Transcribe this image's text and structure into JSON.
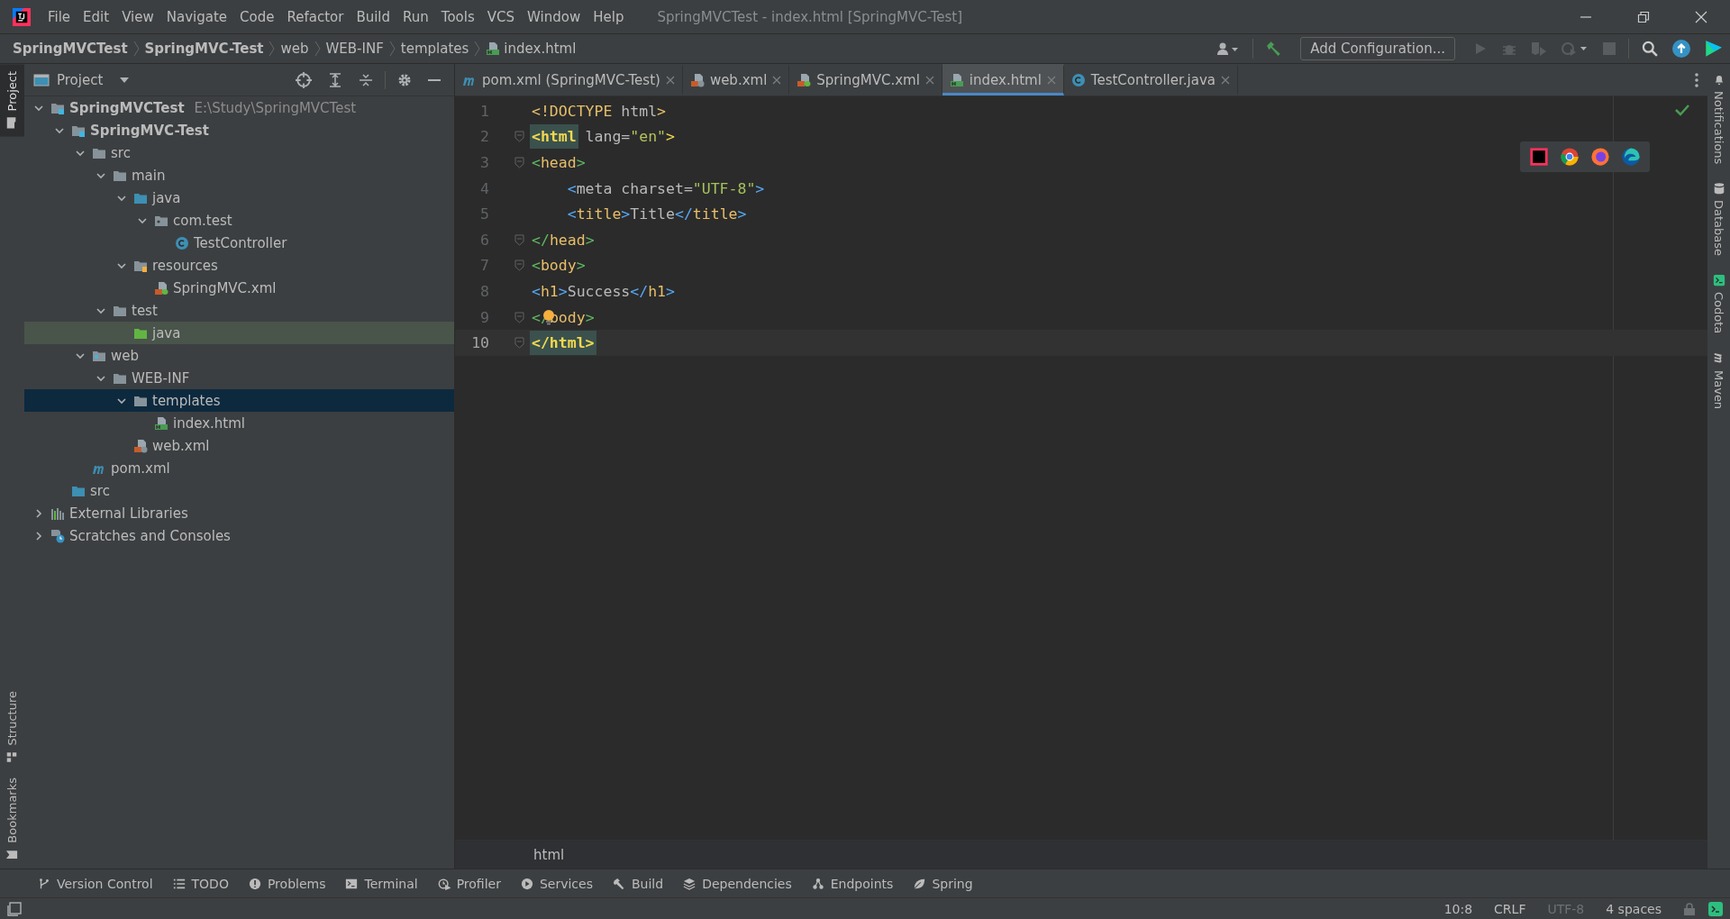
{
  "window": {
    "title": "SpringMVCTest - index.html [SpringMVC-Test]"
  },
  "menu": [
    "File",
    "Edit",
    "View",
    "Navigate",
    "Code",
    "Refactor",
    "Build",
    "Run",
    "Tools",
    "VCS",
    "Window",
    "Help"
  ],
  "breadcrumb": [
    {
      "label": "SpringMVCTest",
      "kind": "module"
    },
    {
      "label": "SpringMVC-Test",
      "kind": "module"
    },
    {
      "label": "web",
      "kind": "folder"
    },
    {
      "label": "WEB-INF",
      "kind": "folder"
    },
    {
      "label": "templates",
      "kind": "folder"
    },
    {
      "label": "index.html",
      "kind": "html"
    }
  ],
  "toolbar": {
    "config_button": "Add Configuration..."
  },
  "left_stripe": [
    {
      "label": "Project",
      "kind": "project",
      "selected": true
    },
    {
      "label": "Structure",
      "kind": "structure",
      "selected": false
    },
    {
      "label": "Bookmarks",
      "kind": "bookmarks",
      "selected": false
    }
  ],
  "project_panel": {
    "title": "Project",
    "tree": [
      {
        "label": "SpringMVCTest",
        "path": "E:\\Study\\SpringMVCTest",
        "kind": "module",
        "expanded": true,
        "selected": false,
        "marked": false,
        "children": [
          {
            "label": "SpringMVC-Test",
            "kind": "module",
            "expanded": true,
            "selected": false,
            "marked": false,
            "children": [
              {
                "label": "src",
                "kind": "folder",
                "expanded": true,
                "selected": false,
                "marked": false,
                "children": [
                  {
                    "label": "main",
                    "kind": "folder",
                    "expanded": true,
                    "selected": false,
                    "marked": false,
                    "children": [
                      {
                        "label": "java",
                        "kind": "source-folder",
                        "expanded": true,
                        "selected": false,
                        "marked": false,
                        "children": [
                          {
                            "label": "com.test",
                            "kind": "package",
                            "expanded": true,
                            "selected": false,
                            "marked": false,
                            "children": [
                              {
                                "label": "TestController",
                                "kind": "class",
                                "selected": false,
                                "marked": false
                              }
                            ]
                          }
                        ]
                      },
                      {
                        "label": "resources",
                        "kind": "resources",
                        "expanded": true,
                        "selected": false,
                        "marked": false,
                        "children": [
                          {
                            "label": "SpringMVC.xml",
                            "kind": "spring-xml",
                            "selected": false,
                            "marked": false
                          }
                        ]
                      }
                    ]
                  },
                  {
                    "label": "test",
                    "kind": "folder",
                    "expanded": true,
                    "selected": false,
                    "marked": false,
                    "children": [
                      {
                        "label": "java",
                        "kind": "test-folder",
                        "selected": false,
                        "marked": true
                      }
                    ]
                  }
                ]
              },
              {
                "label": "web",
                "kind": "web-folder",
                "expanded": true,
                "selected": false,
                "marked": false,
                "children": [
                  {
                    "label": "WEB-INF",
                    "kind": "folder",
                    "expanded": true,
                    "selected": false,
                    "marked": false,
                    "children": [
                      {
                        "label": "templates",
                        "kind": "folder",
                        "expanded": true,
                        "selected": true,
                        "marked": false,
                        "children": [
                          {
                            "label": "index.html",
                            "kind": "html",
                            "selected": false,
                            "marked": false
                          }
                        ]
                      },
                      {
                        "label": "web.xml",
                        "kind": "web-xml",
                        "selected": false,
                        "marked": false
                      }
                    ]
                  }
                ]
              },
              {
                "label": "pom.xml",
                "kind": "maven",
                "selected": false,
                "marked": false
              }
            ]
          },
          {
            "label": "src",
            "kind": "source-folder",
            "selected": false,
            "marked": false
          }
        ]
      },
      {
        "label": "External Libraries",
        "kind": "libraries",
        "expanded": false,
        "selected": false,
        "marked": false
      },
      {
        "label": "Scratches and Consoles",
        "kind": "scratches",
        "expanded": false,
        "selected": false,
        "marked": false
      }
    ]
  },
  "editor": {
    "tabs": [
      {
        "label": "pom.xml (SpringMVC-Test)",
        "kind": "maven",
        "selected": false
      },
      {
        "label": "web.xml",
        "kind": "web-xml",
        "selected": false
      },
      {
        "label": "SpringMVC.xml",
        "kind": "spring-xml",
        "selected": false
      },
      {
        "label": "index.html",
        "kind": "html",
        "selected": true
      },
      {
        "label": "TestController.java",
        "kind": "class",
        "selected": false
      }
    ],
    "lines": [
      {
        "number": "1",
        "fold": false,
        "current": false,
        "bulb": false,
        "indented": false,
        "tokens": [
          {
            "text": "<!DOCTYPE ",
            "color": "#e8bf6a",
            "matched": false
          },
          {
            "text": "html",
            "color": "#bababa",
            "matched": false
          },
          {
            "text": ">",
            "color": "#e8bf6a",
            "matched": false
          }
        ]
      },
      {
        "number": "2",
        "fold": true,
        "current": false,
        "bulb": false,
        "indented": false,
        "tokens": [
          {
            "text": "<html",
            "color": "#f2d94e",
            "matched": true
          },
          {
            "text": " lang=",
            "color": "#bababa",
            "matched": false
          },
          {
            "text": "\"en\"",
            "color": "#b7c25c",
            "matched": false
          },
          {
            "text": ">",
            "color": "#f2d94e",
            "matched": false
          }
        ]
      },
      {
        "number": "3",
        "fold": true,
        "current": false,
        "bulb": false,
        "indented": false,
        "tokens": [
          {
            "text": "<",
            "color": "#5fb760",
            "matched": false
          },
          {
            "text": "head",
            "color": "#e8bf6a",
            "matched": false
          },
          {
            "text": ">",
            "color": "#5fb760",
            "matched": false
          }
        ]
      },
      {
        "number": "4",
        "fold": false,
        "current": false,
        "bulb": false,
        "indented": true,
        "tokens": [
          {
            "text": "<",
            "color": "#56a8f5",
            "matched": false
          },
          {
            "text": "meta charset=",
            "color": "#bababa",
            "matched": false
          },
          {
            "text": "\"UTF-8\"",
            "color": "#a5c25c",
            "matched": false
          },
          {
            "text": ">",
            "color": "#56a8f5",
            "matched": false
          }
        ]
      },
      {
        "number": "5",
        "fold": false,
        "current": false,
        "bulb": false,
        "indented": true,
        "tokens": [
          {
            "text": "<",
            "color": "#56a8f5",
            "matched": false
          },
          {
            "text": "title",
            "color": "#e8bf6a",
            "matched": false
          },
          {
            "text": ">",
            "color": "#56a8f5",
            "matched": false
          },
          {
            "text": "Title",
            "color": "#bababa",
            "matched": false
          },
          {
            "text": "</",
            "color": "#56a8f5",
            "matched": false
          },
          {
            "text": "title",
            "color": "#e8bf6a",
            "matched": false
          },
          {
            "text": ">",
            "color": "#56a8f5",
            "matched": false
          }
        ]
      },
      {
        "number": "6",
        "fold": true,
        "current": false,
        "bulb": false,
        "indented": false,
        "tokens": [
          {
            "text": "</",
            "color": "#5fb760",
            "matched": false
          },
          {
            "text": "head",
            "color": "#e8bf6a",
            "matched": false
          },
          {
            "text": ">",
            "color": "#5fb760",
            "matched": false
          }
        ]
      },
      {
        "number": "7",
        "fold": true,
        "current": false,
        "bulb": false,
        "indented": false,
        "tokens": [
          {
            "text": "<",
            "color": "#5fb760",
            "matched": false
          },
          {
            "text": "body",
            "color": "#e8bf6a",
            "matched": false
          },
          {
            "text": ">",
            "color": "#5fb760",
            "matched": false
          }
        ]
      },
      {
        "number": "8",
        "fold": false,
        "current": false,
        "bulb": false,
        "indented": false,
        "tokens": [
          {
            "text": "<",
            "color": "#56a8f5",
            "matched": false
          },
          {
            "text": "h1",
            "color": "#e8bf6a",
            "matched": false
          },
          {
            "text": ">",
            "color": "#56a8f5",
            "matched": false
          },
          {
            "text": "Success",
            "color": "#bababa",
            "matched": false
          },
          {
            "text": "</",
            "color": "#56a8f5",
            "matched": false
          },
          {
            "text": "h1",
            "color": "#e8bf6a",
            "matched": false
          },
          {
            "text": ">",
            "color": "#56a8f5",
            "matched": false
          }
        ]
      },
      {
        "number": "9",
        "fold": true,
        "current": false,
        "bulb": true,
        "indented": false,
        "tokens": [
          {
            "text": "</",
            "color": "#5fb760",
            "matched": false
          },
          {
            "text": "body",
            "color": "#e8bf6a",
            "matched": false
          },
          {
            "text": ">",
            "color": "#5fb760",
            "matched": false
          }
        ]
      },
      {
        "number": "10",
        "fold": true,
        "current": true,
        "bulb": false,
        "indented": false,
        "tokens": [
          {
            "text": "</html>",
            "color": "#f2d94e",
            "matched": true
          }
        ]
      }
    ],
    "breadcrumb": "html"
  },
  "right_stripe": [
    {
      "label": "Notifications",
      "kind": "bell"
    },
    {
      "label": "Database",
      "kind": "database"
    },
    {
      "label": "Codota",
      "kind": "codota"
    },
    {
      "label": "Maven",
      "kind": "maven"
    }
  ],
  "tool_windows": [
    {
      "label": "Version Control",
      "kind": "vcs"
    },
    {
      "label": "TODO",
      "kind": "todo"
    },
    {
      "label": "Problems",
      "kind": "problems"
    },
    {
      "label": "Terminal",
      "kind": "terminal"
    },
    {
      "label": "Profiler",
      "kind": "profiler"
    },
    {
      "label": "Services",
      "kind": "services"
    },
    {
      "label": "Build",
      "kind": "build"
    },
    {
      "label": "Dependencies",
      "kind": "dependencies"
    },
    {
      "label": "Endpoints",
      "kind": "endpoints"
    },
    {
      "label": "Spring",
      "kind": "spring"
    }
  ],
  "status": [
    {
      "text": "10:8",
      "disabled": false
    },
    {
      "text": "CRLF",
      "disabled": false
    },
    {
      "text": "UTF-8",
      "disabled": true
    },
    {
      "text": "4 spaces",
      "disabled": false
    }
  ]
}
